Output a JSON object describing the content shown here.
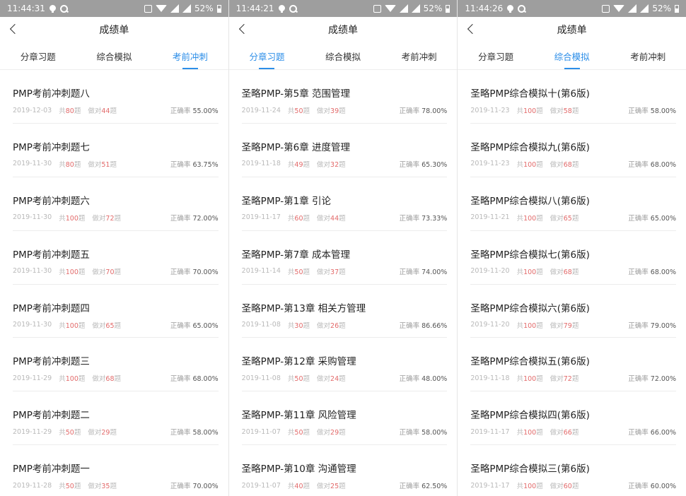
{
  "labels": {
    "total_prefix": "共",
    "total_suffix": "题",
    "correct_prefix": "做对",
    "correct_suffix": "题",
    "rate_label": "正确率"
  },
  "colors": {
    "accent": "#2c8ee8",
    "number_red": "#e26a6a",
    "status_bar": "#9e9e9e"
  },
  "screens": [
    {
      "status": {
        "time": "11:44:31",
        "battery": "52%"
      },
      "nav": {
        "title": "成绩单"
      },
      "tabs": [
        {
          "label": "分章习题",
          "active": false
        },
        {
          "label": "综合模拟",
          "active": false
        },
        {
          "label": "考前冲刺",
          "active": true
        }
      ],
      "items": [
        {
          "title": "PMP考前冲刺题八",
          "date": "2019-12-03",
          "total": "80",
          "correct": "44",
          "rate": "55.00%"
        },
        {
          "title": "PMP考前冲刺题七",
          "date": "2019-11-30",
          "total": "80",
          "correct": "51",
          "rate": "63.75%"
        },
        {
          "title": "PMP考前冲刺题六",
          "date": "2019-11-30",
          "total": "100",
          "correct": "72",
          "rate": "72.00%"
        },
        {
          "title": "PMP考前冲刺题五",
          "date": "2019-11-30",
          "total": "100",
          "correct": "70",
          "rate": "70.00%"
        },
        {
          "title": "PMP考前冲刺题四",
          "date": "2019-11-30",
          "total": "100",
          "correct": "65",
          "rate": "65.00%"
        },
        {
          "title": "PMP考前冲刺题三",
          "date": "2019-11-29",
          "total": "100",
          "correct": "68",
          "rate": "68.00%"
        },
        {
          "title": "PMP考前冲刺题二",
          "date": "2019-11-29",
          "total": "50",
          "correct": "29",
          "rate": "58.00%"
        },
        {
          "title": "PMP考前冲刺题一",
          "date": "2019-11-28",
          "total": "50",
          "correct": "35",
          "rate": "70.00%"
        }
      ]
    },
    {
      "status": {
        "time": "11:44:21",
        "battery": "52%"
      },
      "nav": {
        "title": "成绩单"
      },
      "tabs": [
        {
          "label": "分章习题",
          "active": true
        },
        {
          "label": "综合模拟",
          "active": false
        },
        {
          "label": "考前冲刺",
          "active": false
        }
      ],
      "items": [
        {
          "title": "圣略PMP-第5章 范围管理",
          "date": "2019-11-24",
          "total": "50",
          "correct": "39",
          "rate": "78.00%"
        },
        {
          "title": "圣略PMP-第6章 进度管理",
          "date": "2019-11-18",
          "total": "49",
          "correct": "32",
          "rate": "65.30%"
        },
        {
          "title": "圣略PMP-第1章 引论",
          "date": "2019-11-17",
          "total": "60",
          "correct": "44",
          "rate": "73.33%"
        },
        {
          "title": "圣略PMP-第7章 成本管理",
          "date": "2019-11-14",
          "total": "50",
          "correct": "37",
          "rate": "74.00%"
        },
        {
          "title": "圣略PMP-第13章 相关方管理",
          "date": "2019-11-08",
          "total": "30",
          "correct": "26",
          "rate": "86.66%"
        },
        {
          "title": "圣略PMP-第12章 采购管理",
          "date": "2019-11-08",
          "total": "50",
          "correct": "24",
          "rate": "48.00%"
        },
        {
          "title": "圣略PMP-第11章 风险管理",
          "date": "2019-11-07",
          "total": "50",
          "correct": "29",
          "rate": "58.00%"
        },
        {
          "title": "圣略PMP-第10章 沟通管理",
          "date": "2019-11-07",
          "total": "40",
          "correct": "25",
          "rate": "62.50%"
        }
      ]
    },
    {
      "status": {
        "time": "11:44:26",
        "battery": "52%"
      },
      "nav": {
        "title": "成绩单"
      },
      "tabs": [
        {
          "label": "分章习题",
          "active": false
        },
        {
          "label": "综合模拟",
          "active": true
        },
        {
          "label": "考前冲刺",
          "active": false
        }
      ],
      "items": [
        {
          "title": "圣略PMP综合模拟十(第6版)",
          "date": "2019-11-23",
          "total": "100",
          "correct": "58",
          "rate": "58.00%"
        },
        {
          "title": "圣略PMP综合模拟九(第6版)",
          "date": "2019-11-23",
          "total": "100",
          "correct": "68",
          "rate": "68.00%"
        },
        {
          "title": "圣略PMP综合模拟八(第6版)",
          "date": "2019-11-21",
          "total": "100",
          "correct": "65",
          "rate": "65.00%"
        },
        {
          "title": "圣略PMP综合模拟七(第6版)",
          "date": "2019-11-20",
          "total": "100",
          "correct": "68",
          "rate": "68.00%"
        },
        {
          "title": "圣略PMP综合模拟六(第6版)",
          "date": "2019-11-20",
          "total": "100",
          "correct": "79",
          "rate": "79.00%"
        },
        {
          "title": "圣略PMP综合模拟五(第6版)",
          "date": "2019-11-18",
          "total": "100",
          "correct": "72",
          "rate": "72.00%"
        },
        {
          "title": "圣略PMP综合模拟四(第6版)",
          "date": "2019-11-17",
          "total": "100",
          "correct": "66",
          "rate": "66.00%"
        },
        {
          "title": "圣略PMP综合模拟三(第6版)",
          "date": "2019-11-17",
          "total": "100",
          "correct": "60",
          "rate": "60.00%"
        }
      ]
    }
  ]
}
